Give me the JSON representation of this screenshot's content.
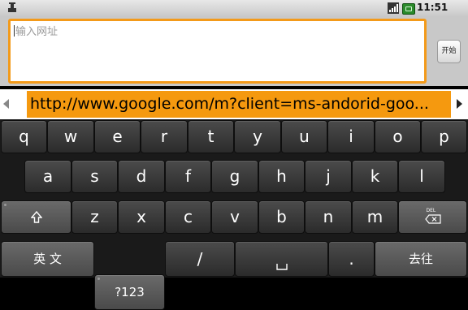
{
  "status_bar": {
    "time": "11:51"
  },
  "url_entry": {
    "placeholder": "输入网址",
    "go_button_label": "开始",
    "accent_color": "#f39a1a"
  },
  "suggestions": {
    "items": [
      "http://www.google.com/m?client=ms-andorid-goo..."
    ]
  },
  "keyboard": {
    "row1": [
      "q",
      "w",
      "e",
      "r",
      "t",
      "y",
      "u",
      "i",
      "o",
      "p"
    ],
    "row2": [
      "a",
      "s",
      "d",
      "f",
      "g",
      "h",
      "j",
      "k",
      "l"
    ],
    "row3": {
      "shift_icon": "shift-icon",
      "letters": [
        "z",
        "x",
        "c",
        "v",
        "b",
        "n",
        "m"
      ],
      "delete_label": "DEL"
    },
    "row4": {
      "lang": "英 文",
      "symbols": "?123",
      "slash": "/",
      "space_icon": "space-icon",
      "dot": ".",
      "go": "去往"
    }
  }
}
